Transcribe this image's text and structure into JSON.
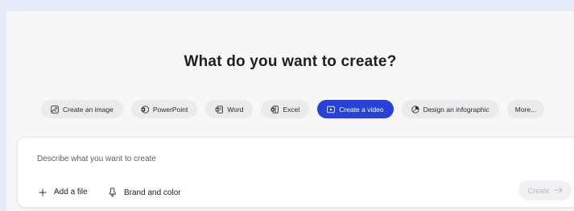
{
  "heading": "What do you want to create?",
  "chips": [
    {
      "label": "Create an image",
      "icon": "image-icon"
    },
    {
      "label": "PowerPoint",
      "icon": "powerpoint-icon"
    },
    {
      "label": "Word",
      "icon": "word-icon"
    },
    {
      "label": "Excel",
      "icon": "excel-icon"
    },
    {
      "label": "Create a video",
      "icon": "video-icon",
      "selected": true
    },
    {
      "label": "Design an infographic",
      "icon": "infographic-icon"
    },
    {
      "label": "More..."
    }
  ],
  "prompt": {
    "placeholder": "Describe what you want to create",
    "add_file_label": "Add a file",
    "brand_label": "Brand and color",
    "create_label": "Create"
  },
  "colors": {
    "accent": "#2742d9",
    "page_background": "#e3ecf8",
    "panel_background": "#f7f7f8"
  }
}
